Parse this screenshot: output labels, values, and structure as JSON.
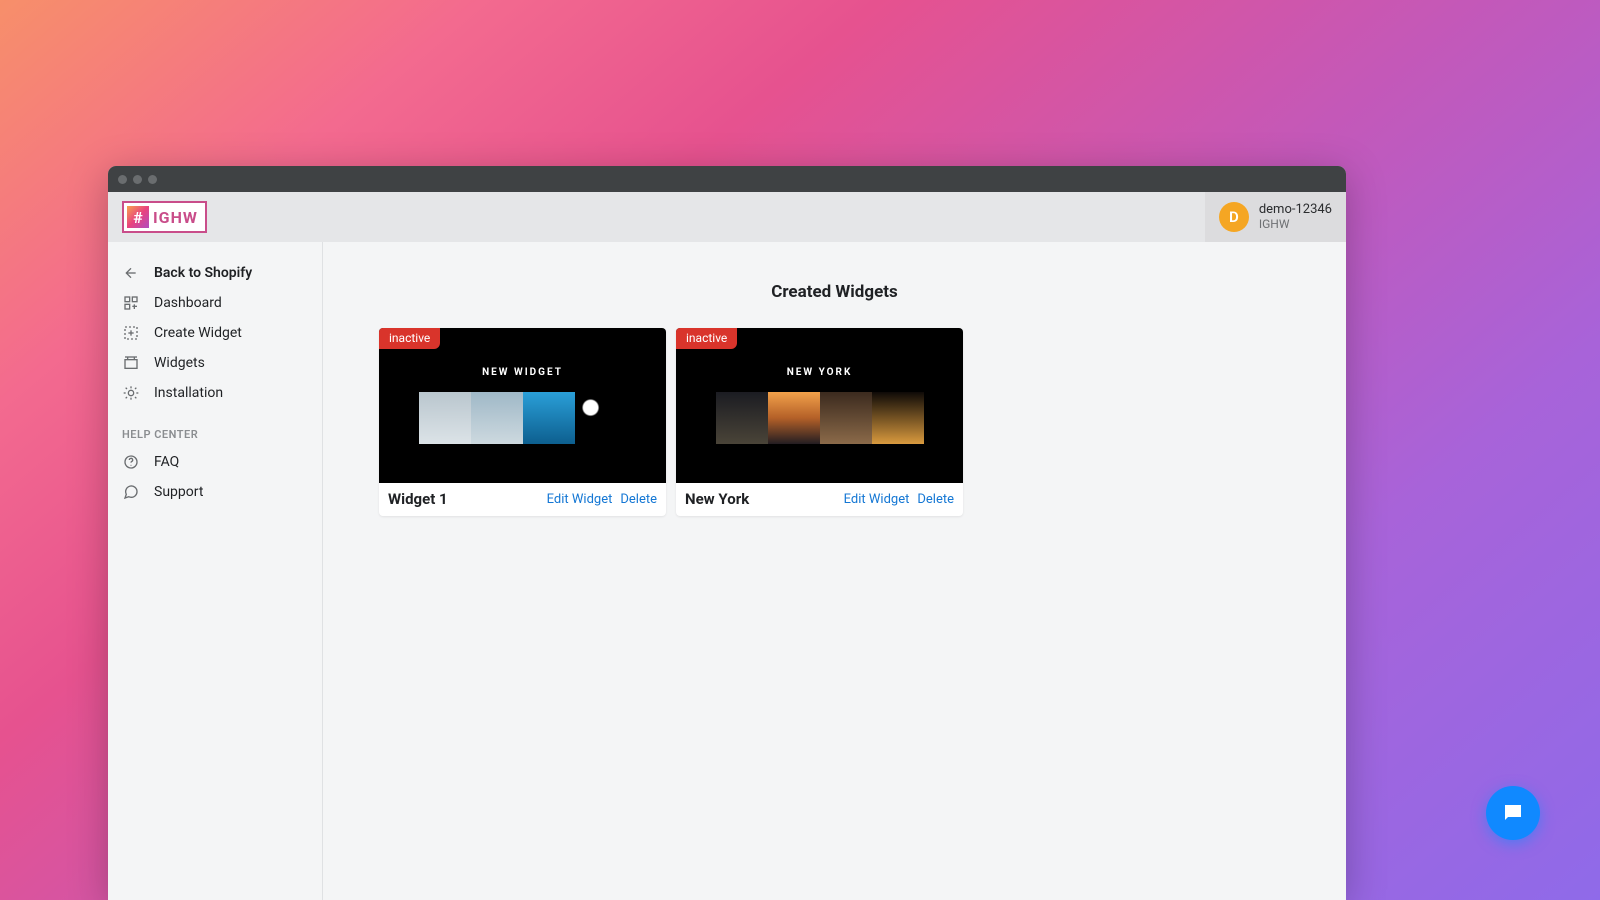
{
  "logo": {
    "hash": "#",
    "text": "IGHW"
  },
  "account": {
    "initial": "D",
    "name": "demo-12346",
    "sub": "IGHW"
  },
  "sidebar": {
    "nav": [
      {
        "label": "Back to Shopify",
        "icon": "arrow-left"
      },
      {
        "label": "Dashboard",
        "icon": "dashboard"
      },
      {
        "label": "Create Widget",
        "icon": "create"
      },
      {
        "label": "Widgets",
        "icon": "widgets"
      },
      {
        "label": "Installation",
        "icon": "install"
      }
    ],
    "help_header": "HELP CENTER",
    "help": [
      {
        "label": "FAQ",
        "icon": "question"
      },
      {
        "label": "Support",
        "icon": "chat"
      }
    ]
  },
  "main": {
    "title": "Created Widgets",
    "edit_label": "Edit Widget",
    "delete_label": "Delete",
    "widgets": [
      {
        "badge": "inactive",
        "preview_title": "NEW WIDGET",
        "name": "Widget 1"
      },
      {
        "badge": "inactive",
        "preview_title": "NEW YORK",
        "name": "New York"
      }
    ]
  },
  "chat": {
    "aria": "Open support chat"
  }
}
